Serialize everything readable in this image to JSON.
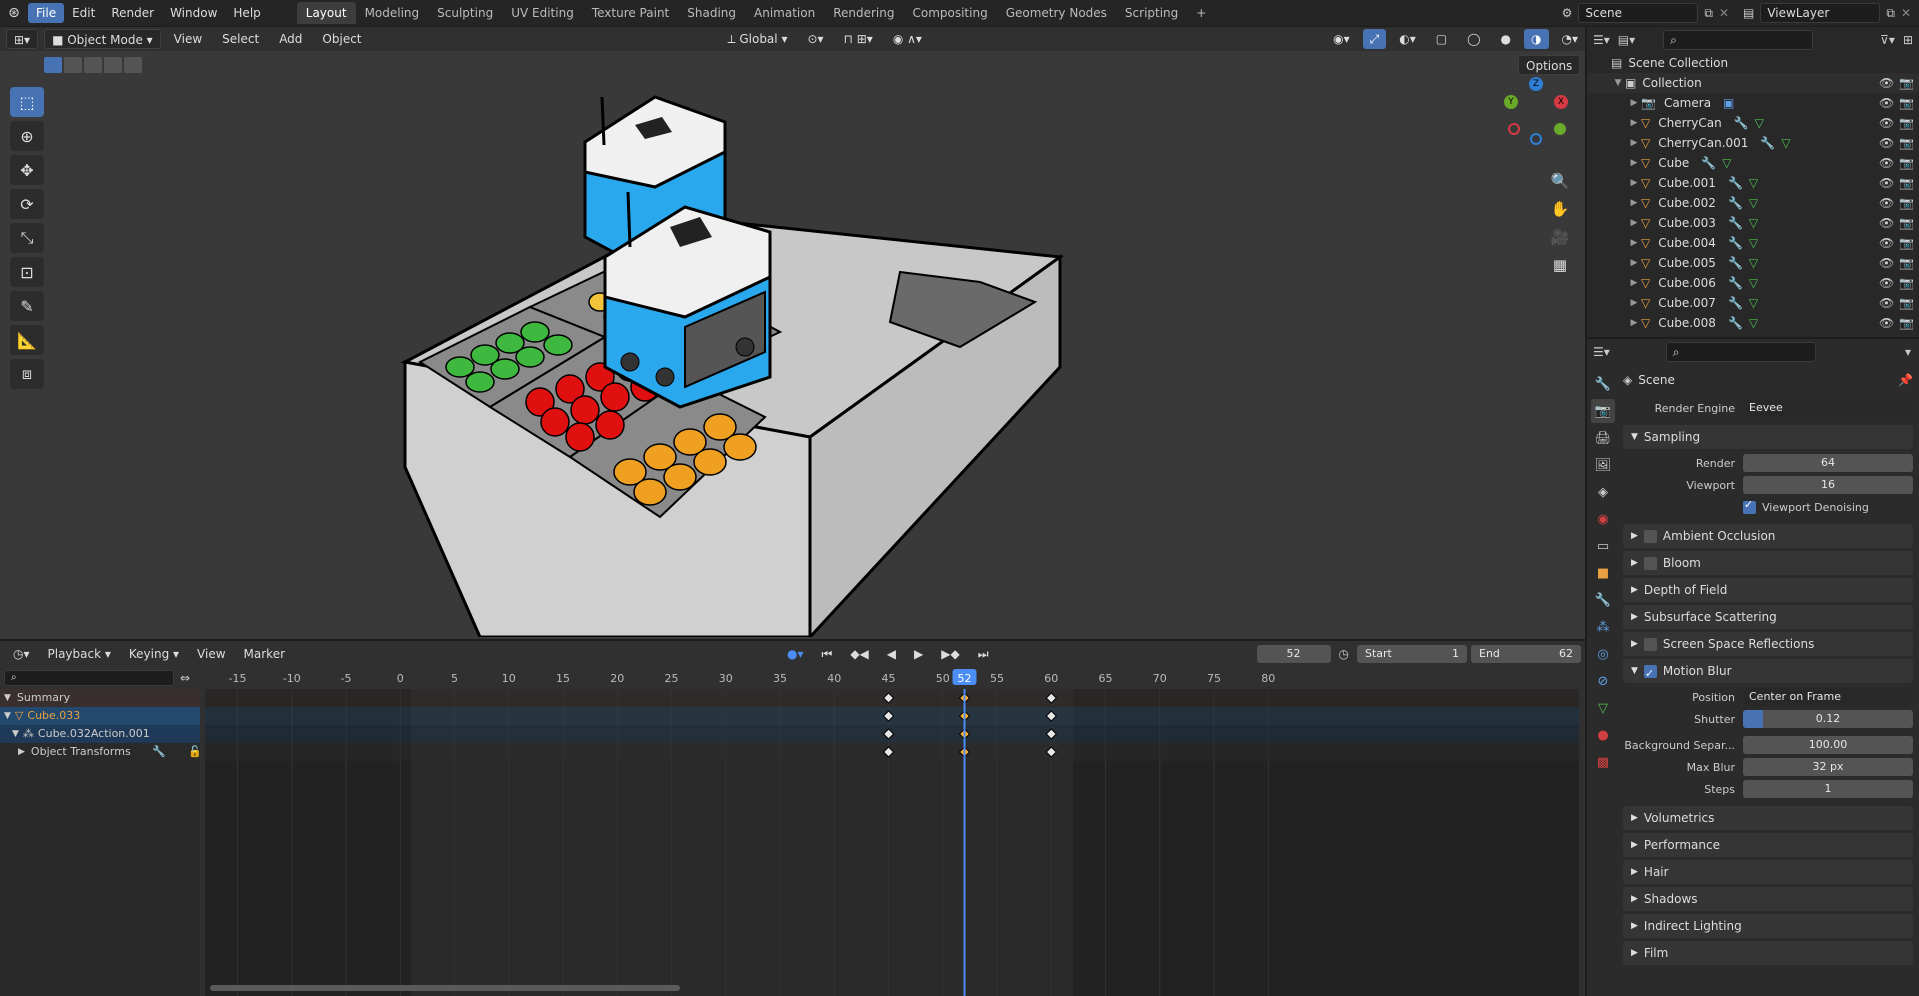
{
  "menus": [
    "File",
    "Edit",
    "Render",
    "Window",
    "Help"
  ],
  "workspaces": [
    "Layout",
    "Modeling",
    "Sculpting",
    "UV Editing",
    "Texture Paint",
    "Shading",
    "Animation",
    "Rendering",
    "Compositing",
    "Geometry Nodes",
    "Scripting",
    "+"
  ],
  "scene_name": "Scene",
  "view_layer": "ViewLayer",
  "viewport": {
    "mode": "Object Mode",
    "menus": [
      "View",
      "Select",
      "Add",
      "Object"
    ],
    "orientation": "Global",
    "options_label": "Options",
    "gizmo": {
      "x": "X",
      "y": "Y",
      "z": "Z"
    }
  },
  "outliner": {
    "root": "Scene Collection",
    "collection": "Collection",
    "items": [
      "Camera",
      "CherryCan",
      "CherryCan.001",
      "Cube",
      "Cube.001",
      "Cube.002",
      "Cube.003",
      "Cube.004",
      "Cube.005",
      "Cube.006",
      "Cube.007",
      "Cube.008"
    ]
  },
  "properties": {
    "scene_label": "Scene",
    "render_engine_label": "Render Engine",
    "render_engine": "Eevee",
    "sampling": {
      "title": "Sampling",
      "render_label": "Render",
      "render": "64",
      "viewport_label": "Viewport",
      "viewport": "16",
      "denoise_label": "Viewport Denoising"
    },
    "panels_a": [
      "Ambient Occlusion",
      "Bloom",
      "Depth of Field",
      "Subsurface Scattering",
      "Screen Space Reflections"
    ],
    "motion_blur": {
      "title": "Motion Blur",
      "position_label": "Position",
      "position": "Center on Frame",
      "shutter_label": "Shutter",
      "shutter": "0.12",
      "bg_label": "Background Separ...",
      "bg": "100.00",
      "maxblur_label": "Max Blur",
      "maxblur": "32 px",
      "steps_label": "Steps",
      "steps": "1"
    },
    "panels_b": [
      "Volumetrics",
      "Performance",
      "Hair",
      "Shadows",
      "Indirect Lighting",
      "Film"
    ]
  },
  "timeline": {
    "menus": [
      "Playback",
      "Keying",
      "View",
      "Marker"
    ],
    "current_frame": "52",
    "start_label": "Start",
    "start": "1",
    "end_label": "End",
    "end": "62",
    "ruler": [
      "-15",
      "-10",
      "-5",
      "0",
      "5",
      "10",
      "15",
      "20",
      "25",
      "30",
      "35",
      "40",
      "45",
      "50",
      "52",
      "55",
      "60",
      "65",
      "70",
      "75",
      "80"
    ],
    "channels": {
      "summary": "Summary",
      "object": "Cube.033",
      "action": "Cube.032Action.001",
      "group": "Object Transforms"
    },
    "keyframes": [
      45,
      52,
      60
    ]
  },
  "colors": {
    "accent": "#4772b3",
    "keyframe_selected": "#ffb22e",
    "playhead": "#4c8cf5"
  }
}
